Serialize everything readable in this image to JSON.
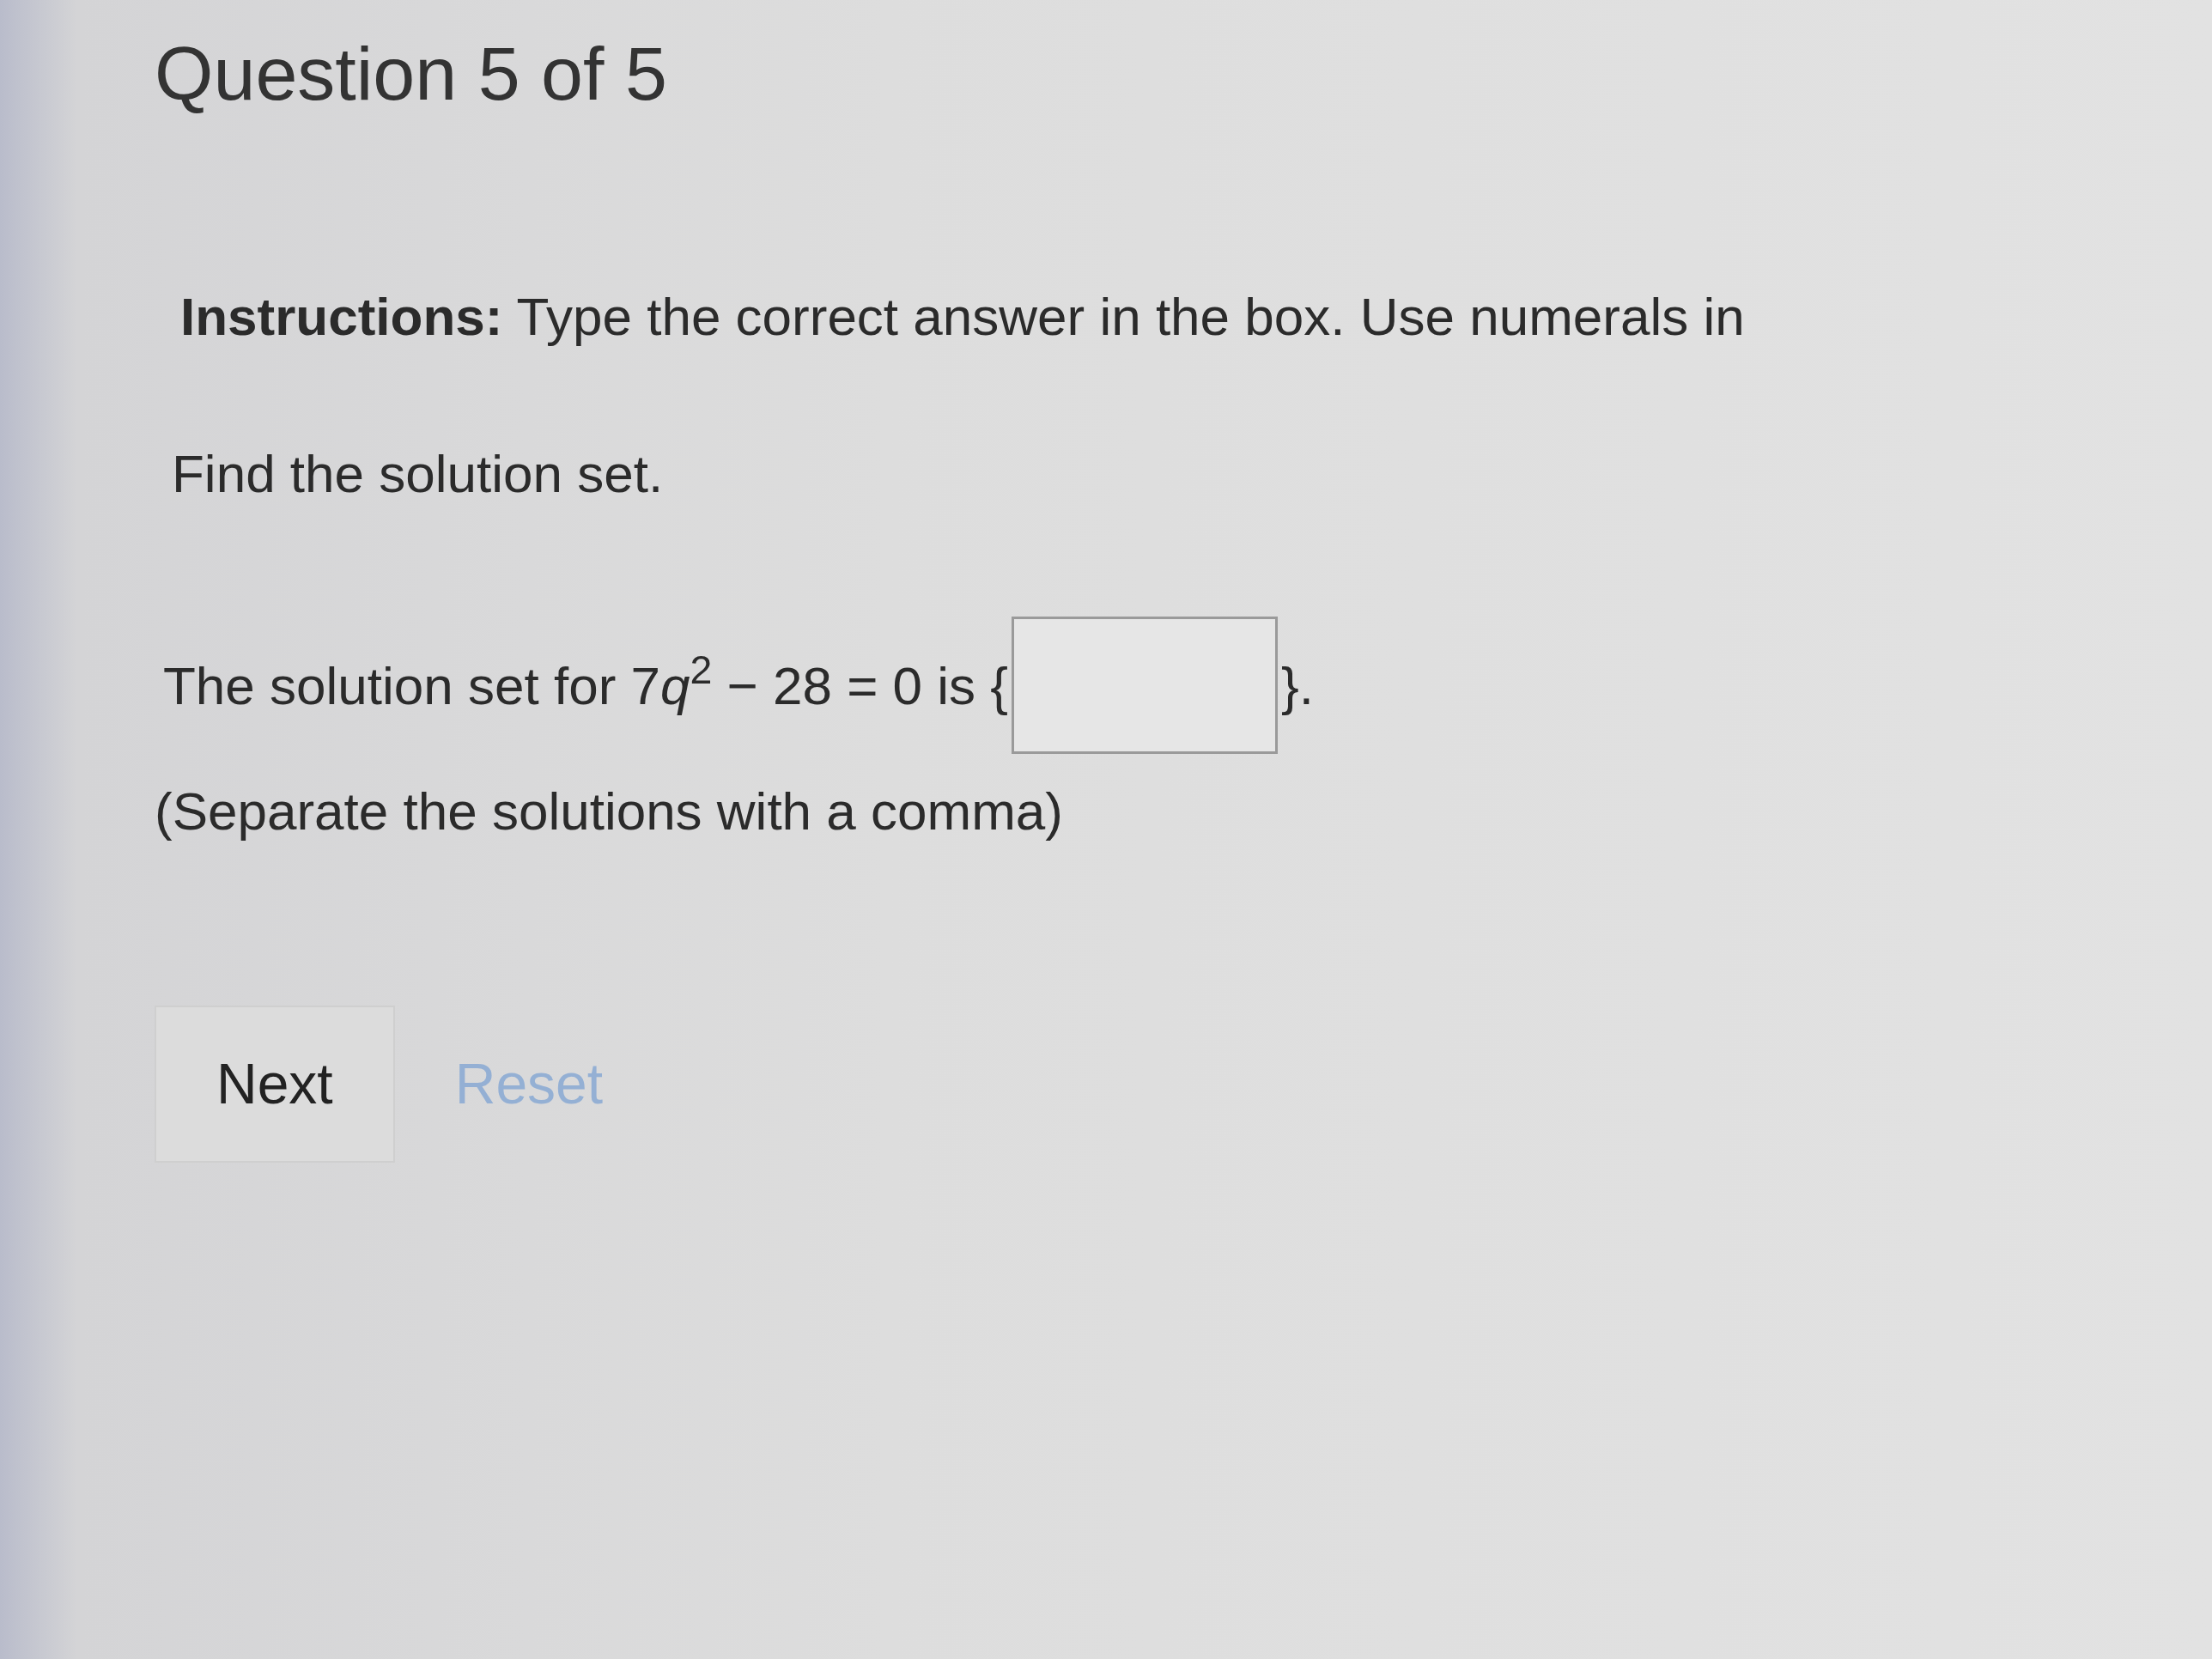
{
  "title": "Question 5 of 5",
  "instructions": "**Instructions:** Type the correct answer in the box. Use numerals in",
  "prompt": "Find the solution set.",
  "equation": {
    "lead": "The solution set for 7",
    "variable": "q",
    "tail": "$^{2}$ − 28 = 0 is {",
    "after": "}."
  },
  "hint": "(Separate the solutions with a comma)",
  "buttons": [
    {
      "label": "Next",
      "kind": "button",
      "disabled": false
    },
    {
      "label": "Reset",
      "kind": "link",
      "disabled": true
    }
  ]
}
